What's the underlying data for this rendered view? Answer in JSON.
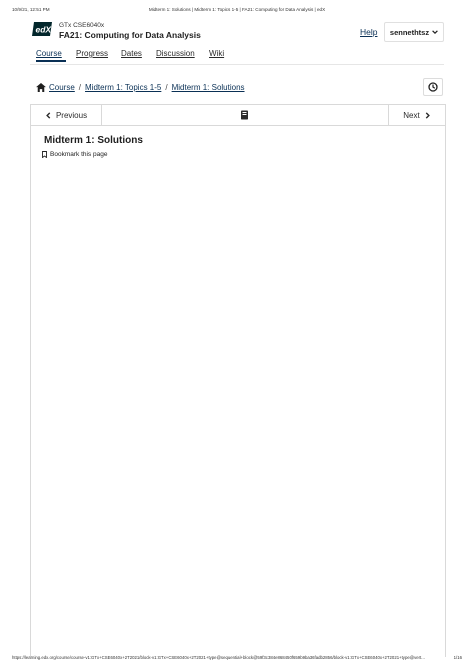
{
  "print_header": {
    "datetime": "10/9/21, 12:51 PM",
    "page_title": "Midterm 1: Solutions | Midterm 1: Topics 1-5 | FA21: Computing for Data Analysis | edX"
  },
  "header": {
    "logo_text": "edX",
    "course_org": "GTx CSE6040x",
    "course_title": "FA21: Computing for Data Analysis",
    "help_label": "Help",
    "username": "sennethtsz"
  },
  "tabs": [
    "Course",
    "Progress",
    "Dates",
    "Discussion",
    "Wiki"
  ],
  "breadcrumb": {
    "items": [
      "Course",
      "Midterm 1: Topics 1-5",
      "Midterm 1: Solutions"
    ],
    "separator": "/"
  },
  "sequence_nav": {
    "previous_label": "Previous",
    "next_label": "Next"
  },
  "unit": {
    "title": "Midterm 1: Solutions",
    "bookmark_label": "Bookmark this page"
  },
  "print_footer": {
    "url": "https://learning.edx.org/course/course-v1:GTx+CSE6040x+2T2021/block-v1:GTx+CSE6040x+2T2021+type@sequential+block@59f3c384e868450f659b9ba36fadb2856/block-v1:GTx+CSE6040x+2T2021+type@vert...",
    "page_number": "1/16"
  },
  "colors": {
    "link": "#0a3055",
    "logo_bg": "#02262b",
    "border": "#d9d9d9"
  }
}
